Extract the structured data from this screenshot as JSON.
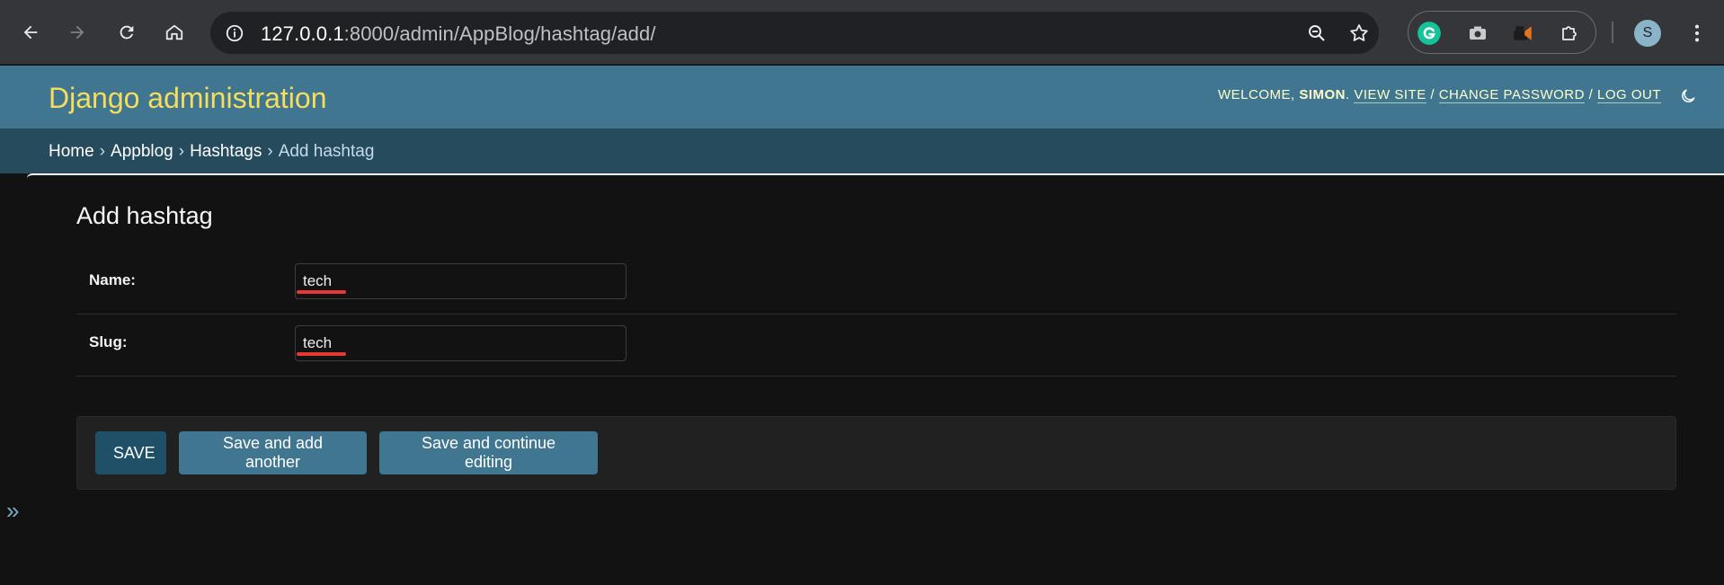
{
  "browser": {
    "url_host": "127.0.0.1",
    "url_rest": ":8000/admin/AppBlog/hashtag/add/",
    "avatar_letter": "S",
    "icons": [
      "back-icon",
      "forward-icon",
      "reload-icon",
      "home-icon",
      "site-info-icon",
      "zoom-icon",
      "bookmark-star-icon",
      "grammarly-icon",
      "camera-icon",
      "extension-puzzle-icon",
      "profile-avatar",
      "more-menu-icon"
    ]
  },
  "header": {
    "site_name": "Django administration",
    "welcome": "Welcome,",
    "username": "Simon",
    "view_site": "View site",
    "change_password": "Change password",
    "log_out": "Log out",
    "separator": "/"
  },
  "breadcrumbs": {
    "home": "Home",
    "app": "Appblog",
    "model": "Hashtags",
    "current": "Add hashtag",
    "sep": "›"
  },
  "sidebar": {
    "toggle": "»"
  },
  "content": {
    "title": "Add hashtag",
    "fields": [
      {
        "label": "Name:",
        "value": "tech"
      },
      {
        "label": "Slug:",
        "value": "tech"
      }
    ],
    "buttons": {
      "save": "SAVE",
      "save_add_another": "Save and add another",
      "save_continue": "Save and continue editing"
    }
  },
  "colors": {
    "header_bg": "#417690",
    "site_name": "#f5dd5d",
    "breadcrumbs_bg": "#264b5d",
    "button": "#417690",
    "button_default": "#205067",
    "page_bg": "#121212"
  }
}
